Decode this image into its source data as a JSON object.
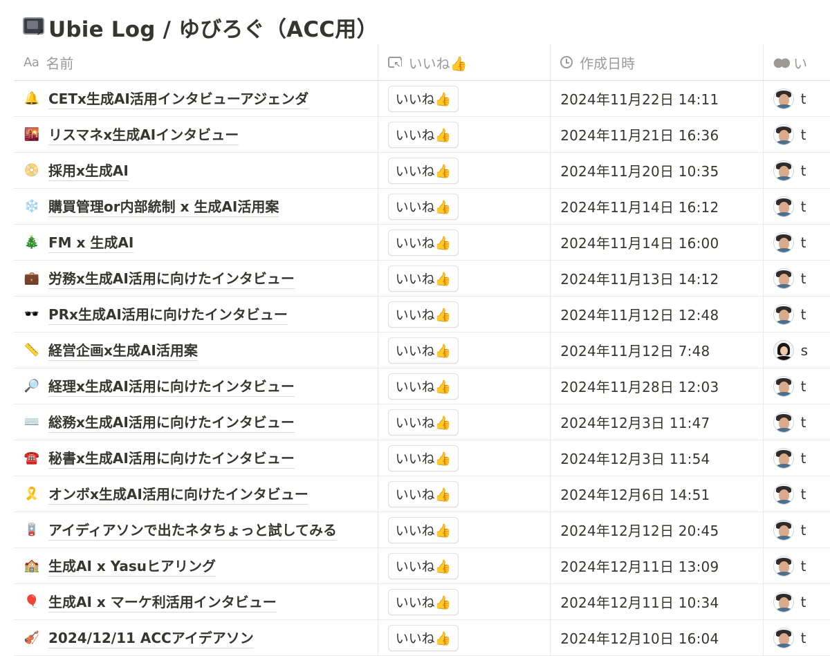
{
  "page": {
    "icon": "desktop-computer-arrow-icon",
    "title": "Ubie Log / ゆびろぐ（ACC用）"
  },
  "columns": {
    "name": {
      "icon": "text-property-icon",
      "icon_text": "Aa",
      "label": "名前"
    },
    "like": {
      "icon": "button-property-icon",
      "label": "いいね👍"
    },
    "created": {
      "icon": "clock-icon",
      "label": "作成日時"
    },
    "person": {
      "icon": "people-icon",
      "label": "い"
    }
  },
  "rows": [
    {
      "emoji": "🔔",
      "title": "CETx生成AI活用インタビューアジェンダ",
      "like": "いいね👍",
      "created": "2024年11月22日 14:11",
      "person_initial": "t",
      "avatar": "man"
    },
    {
      "emoji": "🌇",
      "title": "リスマネx生成AIインタビュー",
      "like": "いいね👍",
      "created": "2024年11月21日 16:36",
      "person_initial": "t",
      "avatar": "man"
    },
    {
      "emoji": "📀",
      "title": "採用x生成AI",
      "like": "いいね👍",
      "created": "2024年11月20日 10:35",
      "person_initial": "t",
      "avatar": "man"
    },
    {
      "emoji": "❄️",
      "title": "購買管理or内部統制 x 生成AI活用案",
      "like": "いいね👍",
      "created": "2024年11月14日 16:12",
      "person_initial": "t",
      "avatar": "man"
    },
    {
      "emoji": "🎄",
      "title": "FM x 生成AI",
      "like": "いいね👍",
      "created": "2024年11月14日 16:00",
      "person_initial": "t",
      "avatar": "man"
    },
    {
      "emoji": "💼",
      "title": "労務x生成AI活用に向けたインタビュー",
      "like": "いいね👍",
      "created": "2024年11月13日 14:12",
      "person_initial": "t",
      "avatar": "man"
    },
    {
      "emoji": "🕶️",
      "title": "PRx生成AI活用に向けたインタビュー",
      "like": "いいね👍",
      "created": "2024年11月12日 12:48",
      "person_initial": "t",
      "avatar": "man"
    },
    {
      "emoji": "📏",
      "title": "経営企画x生成AI活用案",
      "like": "いいね👍",
      "created": "2024年11月12日 7:48",
      "person_initial": "s",
      "avatar": "woman"
    },
    {
      "emoji": "🔎",
      "title": "経理x生成AI活用に向けたインタビュー",
      "like": "いいね👍",
      "created": "2024年11月28日 12:03",
      "person_initial": "t",
      "avatar": "man"
    },
    {
      "emoji": "⌨️",
      "title": "総務x生成AI活用に向けたインタビュー",
      "like": "いいね👍",
      "created": "2024年12月3日 11:47",
      "person_initial": "t",
      "avatar": "man"
    },
    {
      "emoji": "☎️",
      "title": "秘書x生成AI活用に向けたインタビュー",
      "like": "いいね👍",
      "created": "2024年12月3日 11:54",
      "person_initial": "t",
      "avatar": "man"
    },
    {
      "emoji": "🎗️",
      "title": "オンボx生成AI活用に向けたインタビュー",
      "like": "いいね👍",
      "created": "2024年12月6日 14:51",
      "person_initial": "t",
      "avatar": "man"
    },
    {
      "emoji": "🪫",
      "title": "アイディアソンで出たネタちょっと試してみる",
      "like": "いいね👍",
      "created": "2024年12月12日 20:45",
      "person_initial": "t",
      "avatar": "man"
    },
    {
      "emoji": "🏫",
      "title": "生成AI x Yasuヒアリング",
      "like": "いいね👍",
      "created": "2024年12月11日 13:09",
      "person_initial": "t",
      "avatar": "man"
    },
    {
      "emoji": "🎈",
      "title": "生成AI x マーケ利活用インタビュー",
      "like": "いいね👍",
      "created": "2024年12月11日 10:34",
      "person_initial": "t",
      "avatar": "man"
    },
    {
      "emoji": "🎻",
      "title": "2024/12/11 ACCアイデアソン",
      "like": "いいね👍",
      "created": "2024年12月10日 16:04",
      "person_initial": "t",
      "avatar": "man"
    }
  ]
}
